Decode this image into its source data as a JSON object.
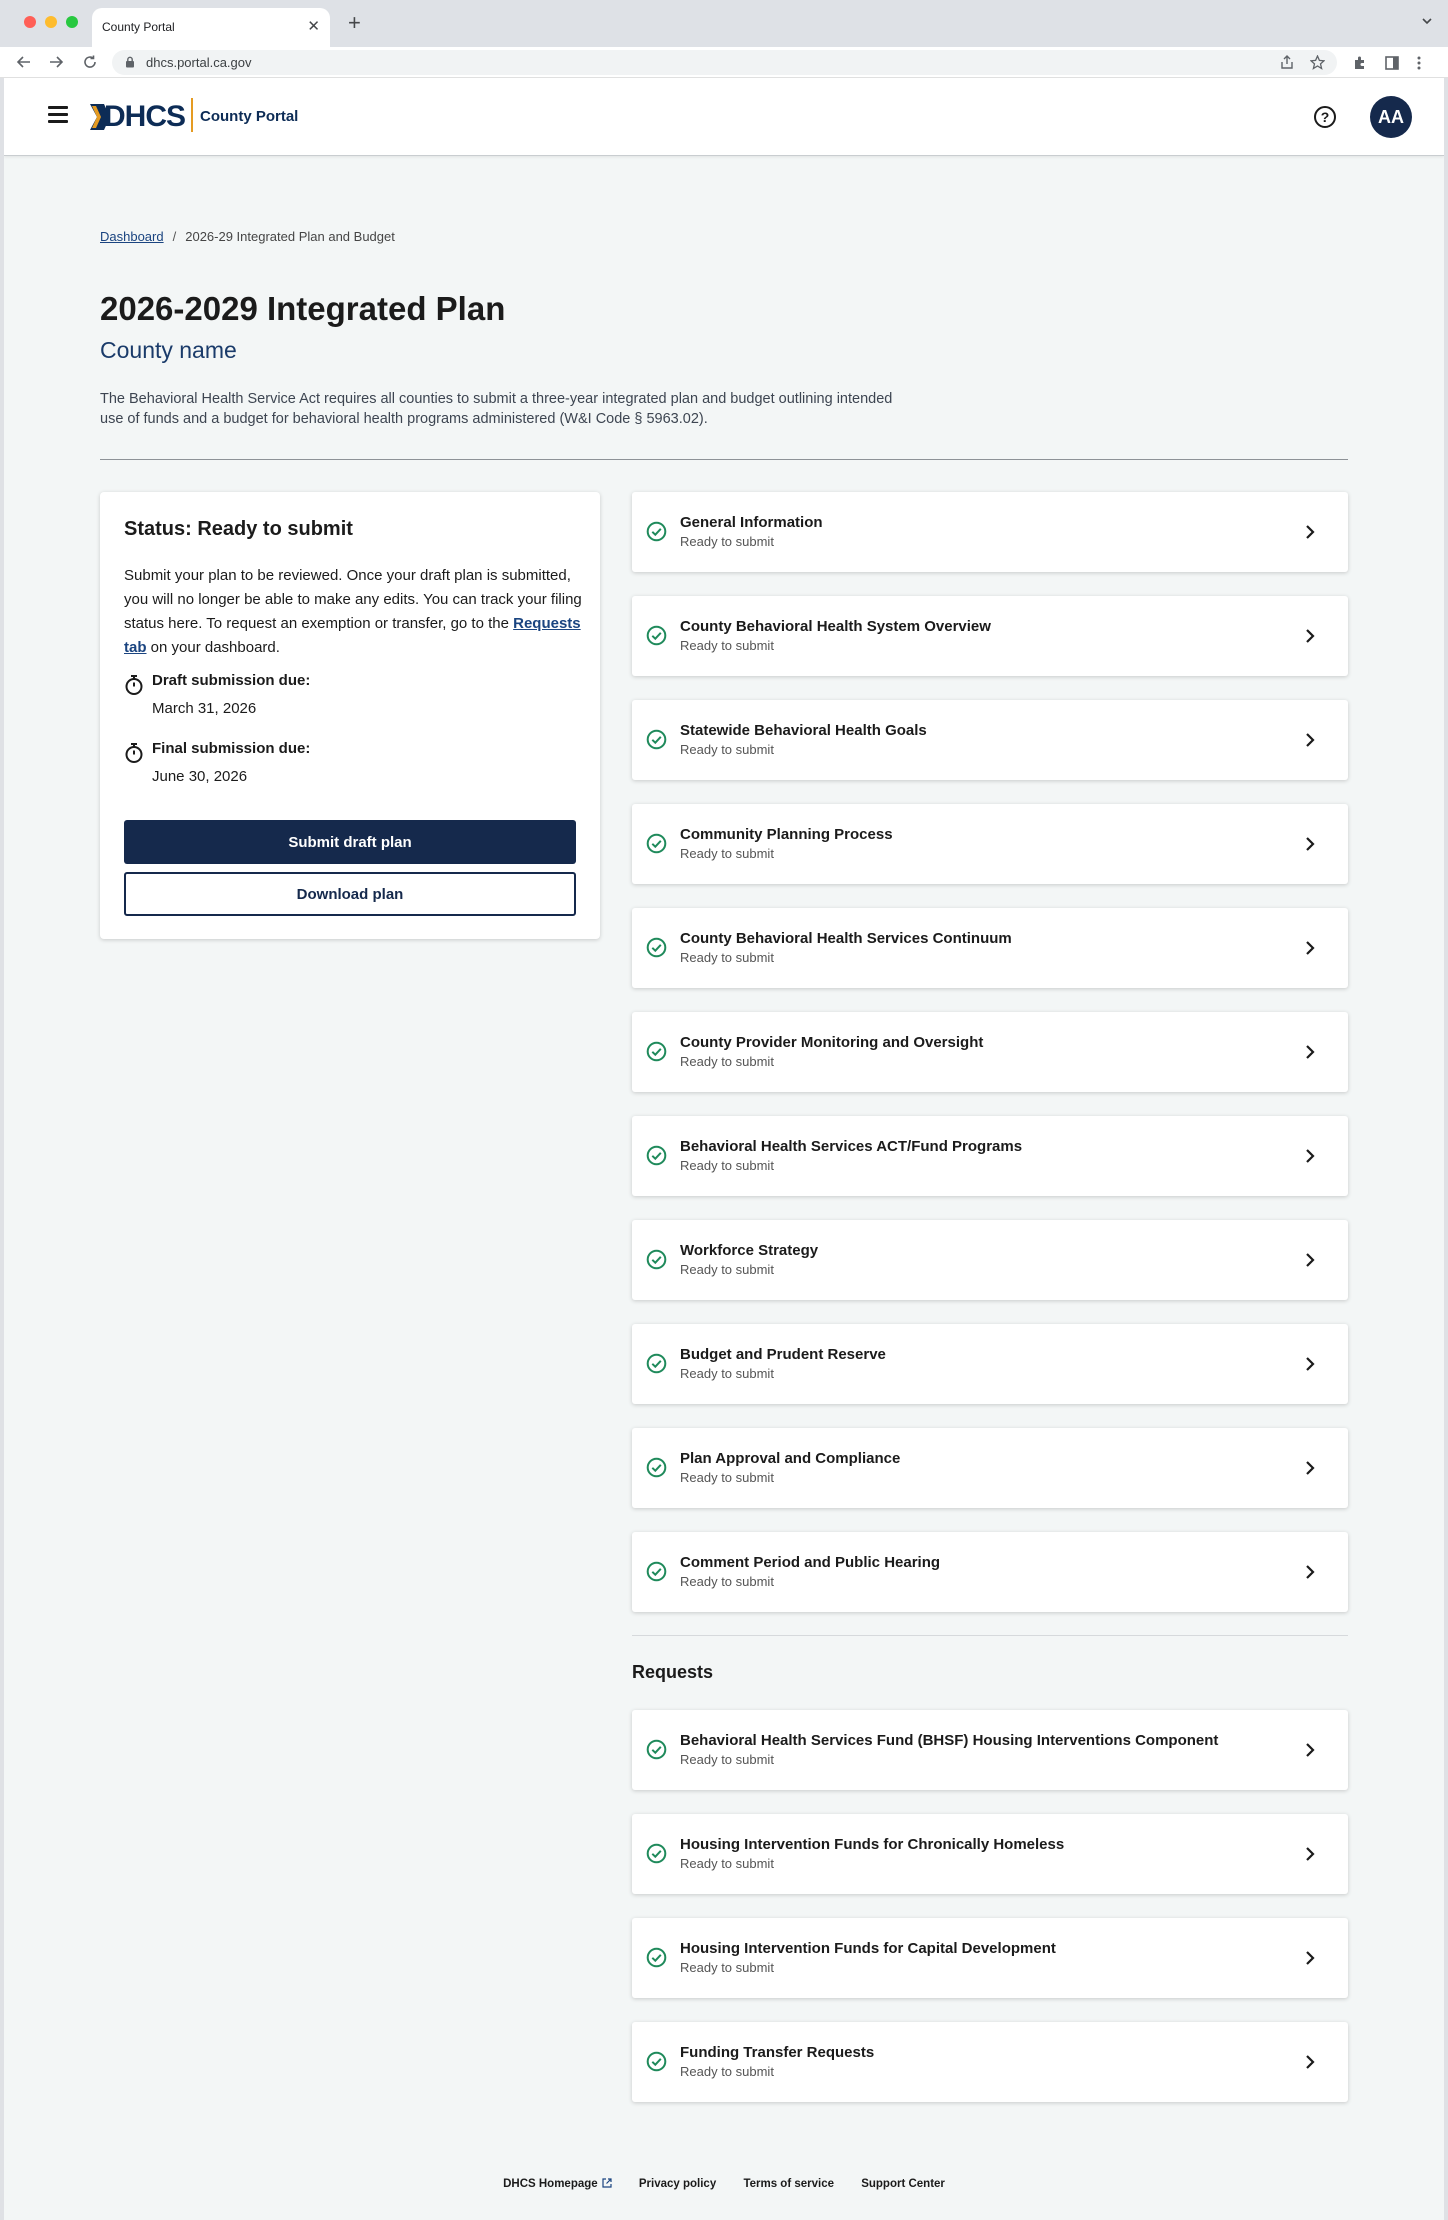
{
  "browser": {
    "tab_title": "County Portal",
    "url": "dhcs.portal.ca.gov"
  },
  "header": {
    "logo_text": "DHCS",
    "portal_label": "County Portal",
    "help_label": "?",
    "avatar_initials": "AA"
  },
  "breadcrumb": {
    "home": "Dashboard",
    "separator": "/",
    "current": "2026-29 Integrated Plan and Budget"
  },
  "page": {
    "title": "2026-2029 Integrated Plan",
    "county": "County name",
    "intro": "The Behavioral Health Service Act requires all counties to submit a three-year integrated plan and budget outlining intended use of funds and a budget for behavioral health programs administered (W&I Code § 5963.02)."
  },
  "status_card": {
    "title": "Status: Ready to submit",
    "body_before": "Submit your plan to be reviewed. Once your draft plan is submitted, you will no longer be able to make any edits. You can track your filing status here. To request an exemption or transfer, go to the ",
    "link": "Requests tab",
    "body_after": " on your dashboard.",
    "draft_label": "Draft submission due:",
    "draft_date": "March 31, 2026",
    "final_label": "Final submission due:",
    "final_date": "June 30, 2026",
    "submit_button": "Submit draft plan",
    "download_button": "Download plan"
  },
  "sections": [
    {
      "title": "General Information",
      "status": "Ready to submit"
    },
    {
      "title": "County Behavioral Health System Overview",
      "status": "Ready to submit"
    },
    {
      "title": "Statewide Behavioral Health Goals",
      "status": "Ready to submit"
    },
    {
      "title": "Community Planning Process",
      "status": "Ready to submit"
    },
    {
      "title": "County Behavioral Health Services Continuum",
      "status": "Ready to submit"
    },
    {
      "title": "County Provider Monitoring and Oversight",
      "status": "Ready to submit"
    },
    {
      "title": "Behavioral Health Services ACT/Fund Programs",
      "status": "Ready to submit"
    },
    {
      "title": "Workforce Strategy",
      "status": "Ready to submit"
    },
    {
      "title": "Budget and Prudent Reserve",
      "status": "Ready to submit"
    },
    {
      "title": "Plan Approval and Compliance",
      "status": "Ready to submit"
    },
    {
      "title": "Comment Period and Public Hearing",
      "status": "Ready to submit"
    }
  ],
  "requests": {
    "heading": "Requests",
    "items": [
      {
        "title": "Behavioral Health Services Fund (BHSF) Housing Interventions Component",
        "status": "Ready to submit"
      },
      {
        "title": "Housing Intervention Funds for Chronically Homeless",
        "status": "Ready to submit"
      },
      {
        "title": "Housing Intervention Funds for Capital Development",
        "status": "Ready to submit"
      },
      {
        "title": "Funding Transfer Requests",
        "status": "Ready to submit"
      }
    ]
  },
  "footer": {
    "links": [
      "DHCS Homepage",
      "Privacy policy",
      "Terms of service",
      "Support Center"
    ]
  },
  "colors": {
    "primary": "#15294c",
    "link": "#1a4480",
    "success": "#1f8a5b",
    "page_bg": "#f3f6f6",
    "accent": "#e59b22"
  },
  "icons": {
    "menu": "hamburger-menu-icon",
    "help": "question-circle-icon",
    "timer": "stopwatch-icon",
    "check": "check-circle-icon",
    "chevron": "chevron-right-icon",
    "external": "external-link-icon"
  }
}
